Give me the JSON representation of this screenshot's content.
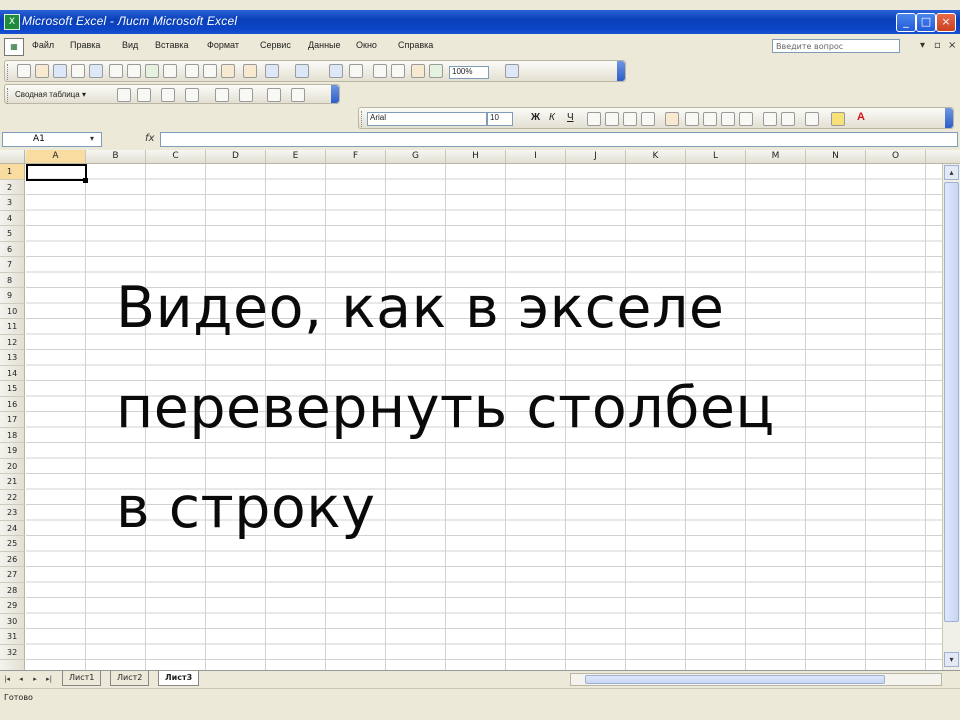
{
  "window": {
    "title": "Microsoft Excel - Лист Microsoft Excel",
    "app_icon": "excel-icon",
    "buttons": [
      "_",
      "□",
      "×"
    ]
  },
  "menu": {
    "items": [
      "Файл",
      "Правка",
      "Вид",
      "Вставка",
      "Формат",
      "Сервис",
      "Данные",
      "Окно",
      "Справка"
    ],
    "help_placeholder": "Введите вопрос",
    "zoom": "100%"
  },
  "format_toolbar": {
    "font": "Arial",
    "size": "10"
  },
  "pivot_toolbar": {
    "label": "Сводная таблица ▾"
  },
  "formula_bar": {
    "name_box": "A1",
    "fx": "fx",
    "value": ""
  },
  "grid": {
    "columns": [
      "A",
      "B",
      "C",
      "D",
      "E",
      "F",
      "G",
      "H",
      "I",
      "J",
      "K",
      "L",
      "M",
      "N",
      "O"
    ],
    "rows": [
      "1",
      "2",
      "3",
      "4",
      "5",
      "6",
      "7",
      "8",
      "9",
      "10",
      "11",
      "12",
      "13",
      "14",
      "15",
      "16",
      "17",
      "18",
      "19",
      "20",
      "21",
      "22",
      "23",
      "24",
      "25",
      "26",
      "27",
      "28",
      "29",
      "30",
      "31",
      "32"
    ],
    "active_cell": "A1"
  },
  "sheets": {
    "tabs": [
      "Лист1",
      "Лист2",
      "Лист3"
    ],
    "active": "Лист3"
  },
  "status": {
    "text": "Готово"
  },
  "overlay": {
    "lines": [
      "Видео, как в экселе",
      "перевернуть столбец",
      "в строку"
    ]
  }
}
